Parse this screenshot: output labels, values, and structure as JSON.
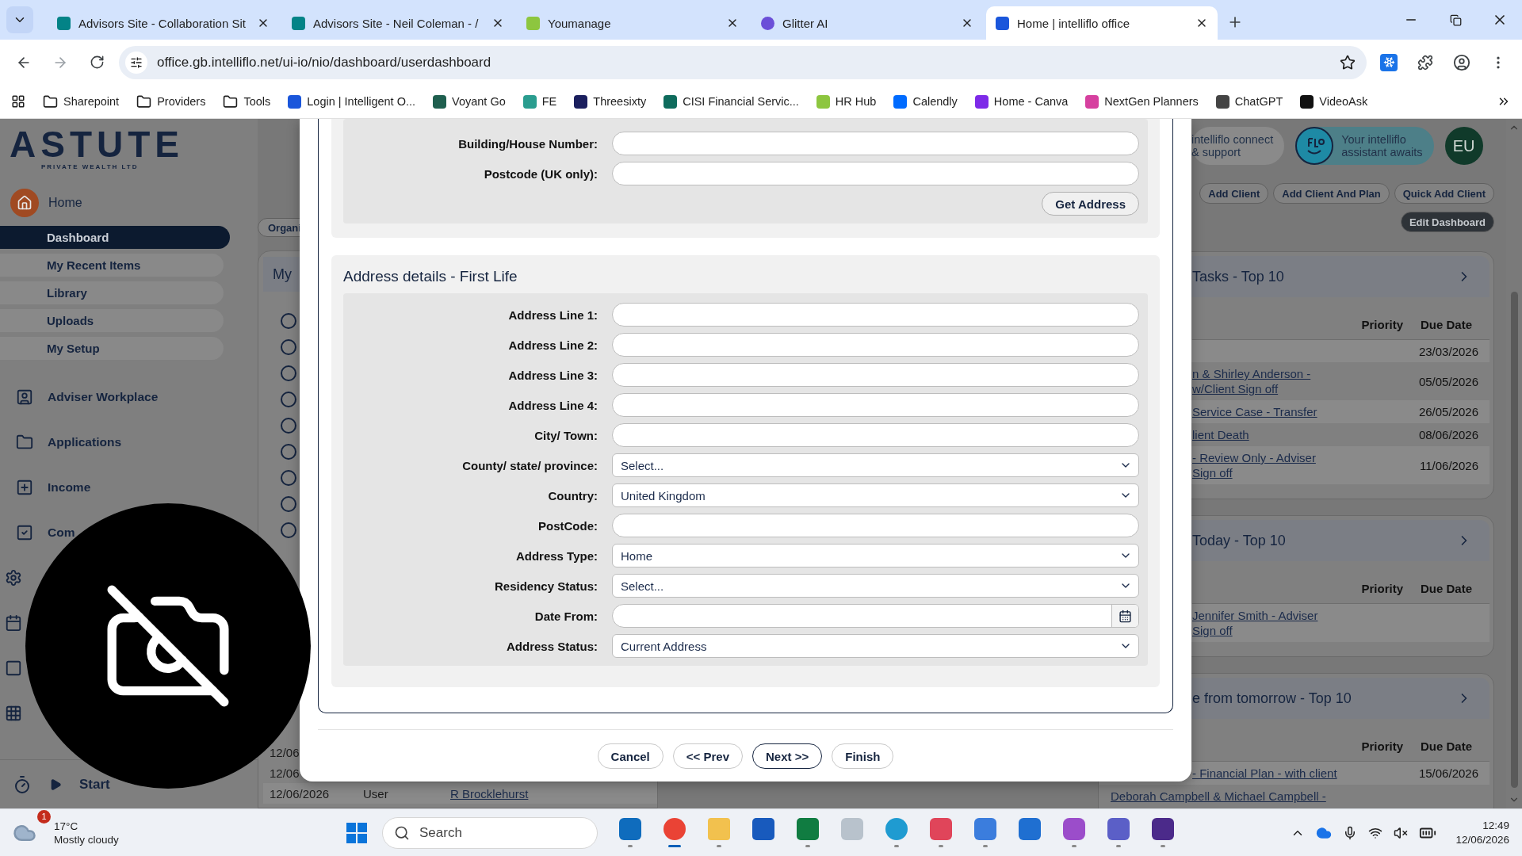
{
  "browser": {
    "tabs": [
      {
        "title": "Advisors Site - Collaboration Sit",
        "kind": "sharepoint",
        "selected": false
      },
      {
        "title": "Advisors Site - Neil Coleman - /",
        "kind": "sharepoint",
        "selected": false
      },
      {
        "title": "Youmanage",
        "kind": "youmanage",
        "selected": false
      },
      {
        "title": "Glitter AI",
        "kind": "glitter",
        "selected": false
      },
      {
        "title": "Home | intelliflo office",
        "kind": "intelliflo",
        "selected": true
      }
    ],
    "address": "office.gb.intelliflo.net/ui-io/nio/dashboard/userdashboard",
    "bookmarks": [
      {
        "label": "Sharepoint",
        "kind": "folder"
      },
      {
        "label": "Providers",
        "kind": "folder"
      },
      {
        "label": "Tools",
        "kind": "folder"
      },
      {
        "label": "Login | Intelligent O...",
        "kind": "site",
        "color": "#1a56db"
      },
      {
        "label": "Voyant Go",
        "kind": "site",
        "color": "#1f5f4f"
      },
      {
        "label": "FE",
        "kind": "site",
        "color": "#2a9d8f"
      },
      {
        "label": "Threesixty",
        "kind": "site",
        "color": "#1b1f5e"
      },
      {
        "label": "CISI Financial Servic...",
        "kind": "site",
        "color": "#0e6b5c"
      },
      {
        "label": "HR Hub",
        "kind": "site",
        "color": "#8dc63f"
      },
      {
        "label": "Calendly",
        "kind": "site",
        "color": "#006bff"
      },
      {
        "label": "Home - Canva",
        "kind": "site",
        "color": "#7d2ae8"
      },
      {
        "label": "NextGen Planners",
        "kind": "site",
        "color": "#d6409f"
      },
      {
        "label": "ChatGPT",
        "kind": "site",
        "color": "#444444"
      },
      {
        "label": "VideoAsk",
        "kind": "site",
        "color": "#111111"
      }
    ]
  },
  "sidebar": {
    "logo": "ASTUTE",
    "logo_sub": "PRIVATE WEALTH LTD",
    "home": "Home",
    "subnav": [
      {
        "label": "Dashboard",
        "selected": true
      },
      {
        "label": "My Recent Items",
        "selected": false
      },
      {
        "label": "Library",
        "selected": false
      },
      {
        "label": "Uploads",
        "selected": false
      },
      {
        "label": "My Setup",
        "selected": false
      }
    ],
    "items": [
      {
        "label": "Adviser Workplace",
        "kind": "person"
      },
      {
        "label": "Applications",
        "kind": "folder"
      },
      {
        "label": "Income",
        "kind": "plus"
      },
      {
        "label": "Com",
        "kind": "check"
      },
      {
        "kind": "gear"
      },
      {
        "kind": "calendar"
      },
      {
        "kind": "square"
      },
      {
        "kind": "grid"
      }
    ],
    "timer": "Start"
  },
  "middle": {
    "chip": "Organi",
    "card_title": "My",
    "radios": [
      {
        "checked": false
      },
      {
        "checked": false
      },
      {
        "checked": false
      },
      {
        "checked": false
      },
      {
        "checked": false
      },
      {
        "checked": false
      },
      {
        "checked": false
      },
      {
        "checked": false
      },
      {
        "checked": false
      }
    ],
    "rows": [
      {
        "date": "12/06"
      },
      {
        "date": "12/06"
      },
      {
        "date": "12/06/2026",
        "type": "User",
        "name": "R Brocklehurst"
      }
    ]
  },
  "right": {
    "connect": [
      "intelliflo connect",
      "& support"
    ],
    "assistant": [
      "Your intelliflo",
      "assistant awaits"
    ],
    "avatar": "EU",
    "actions": [
      "Add Client",
      "Add Client And Plan",
      "Quick Add Client"
    ],
    "edit": "Edit Dashboard",
    "cards": [
      {
        "title": "Tasks - Top 10",
        "columns": [
          "Priority",
          "Due Date"
        ],
        "rows": [
          {
            "due": "23/03/2026"
          },
          {
            "link": [
              "n & Shirley Anderson -",
              "w/Client Sign off"
            ],
            "due": "05/05/2026"
          },
          {
            "link": [
              "Service Case - Transfer"
            ],
            "due": "26/05/2026"
          },
          {
            "link": [
              "lient Death"
            ],
            "due": "08/06/2026"
          },
          {
            "link": [
              "- Review Only - Adviser",
              "Sign off"
            ],
            "due": "11/06/2026"
          }
        ]
      },
      {
        "title": "Today - Top 10",
        "columns": [
          "Priority",
          "Due Date"
        ],
        "rows": [
          {
            "link": [
              "Jennifer Smith - Adviser",
              "Sign off"
            ]
          }
        ]
      },
      {
        "title": "e from tomorrow - Top 10",
        "columns": [
          "Priority",
          "Due Date"
        ],
        "rows": [
          {
            "link": [
              "- Financial Plan - with client"
            ],
            "due": "15/06/2026"
          },
          {
            "link": [
              "Deborah Campbell & Michael Campbell -"
            ]
          }
        ]
      }
    ]
  },
  "modal": {
    "lookup": [
      {
        "label": "Building/House Number:",
        "kind": "text"
      },
      {
        "label": "Postcode (UK only):",
        "kind": "text"
      }
    ],
    "lookup_button": "Get Address",
    "section_title": "Address details - First Life",
    "fields": [
      {
        "label": "Address Line 1:",
        "kind": "text"
      },
      {
        "label": "Address Line 2:",
        "kind": "text"
      },
      {
        "label": "Address Line 3:",
        "kind": "text"
      },
      {
        "label": "Address Line 4:",
        "kind": "text"
      },
      {
        "label": "City/ Town:",
        "kind": "text"
      },
      {
        "label": "County/ state/ province:",
        "kind": "select",
        "value": "Select..."
      },
      {
        "label": "Country:",
        "kind": "select",
        "value": "United Kingdom"
      },
      {
        "label": "PostCode:",
        "kind": "text"
      },
      {
        "label": "Address Type:",
        "kind": "select",
        "value": "Home"
      },
      {
        "label": "Residency Status:",
        "kind": "select",
        "value": "Select..."
      },
      {
        "label": "Date From:",
        "kind": "date"
      },
      {
        "label": "Address Status:",
        "kind": "select",
        "value": "Current Address"
      }
    ],
    "buttons": [
      {
        "label": "Cancel",
        "primary": false
      },
      {
        "label": "<< Prev",
        "primary": false
      },
      {
        "label": "Next >>",
        "primary": true
      },
      {
        "label": "Finish",
        "primary": false
      }
    ]
  },
  "taskbar": {
    "weather": {
      "badge": "1",
      "temp": "17°C",
      "desc": "Mostly cloudy"
    },
    "search": "Search",
    "apps": [
      {
        "kind": "mail",
        "running": true,
        "selected": false
      },
      {
        "kind": "browser",
        "running": true,
        "selected": true
      },
      {
        "kind": "files",
        "running": true,
        "selected": false
      },
      {
        "kind": "word",
        "running": false,
        "selected": false
      },
      {
        "kind": "excel",
        "running": true,
        "selected": false
      },
      {
        "kind": "disk",
        "running": false,
        "selected": false
      },
      {
        "kind": "edge",
        "running": true,
        "selected": false
      },
      {
        "kind": "snip",
        "running": true,
        "selected": false
      },
      {
        "kind": "folderapp",
        "running": true,
        "selected": false
      },
      {
        "kind": "snowflake",
        "running": false,
        "selected": false
      },
      {
        "kind": "copilot",
        "running": true,
        "selected": false
      },
      {
        "kind": "teams",
        "running": true,
        "selected": false
      },
      {
        "kind": "purple",
        "running": true,
        "selected": false
      }
    ],
    "time": "12:49",
    "date": "12/06/2026"
  }
}
